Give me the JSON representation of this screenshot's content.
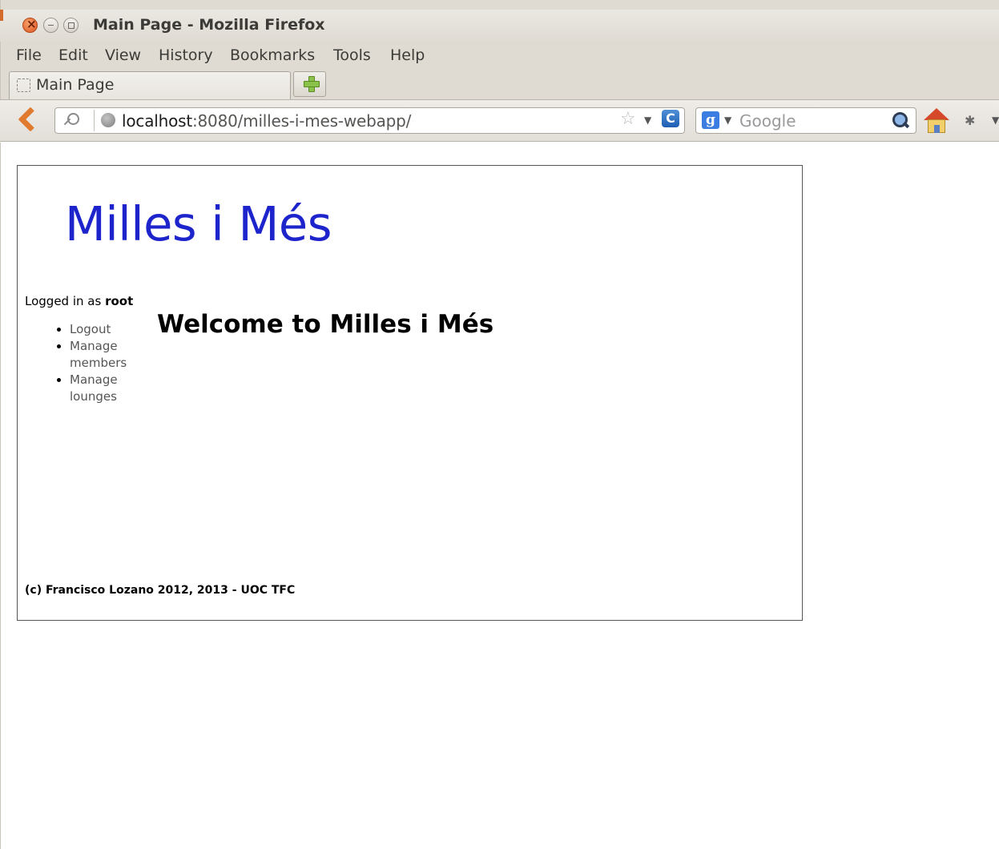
{
  "window": {
    "title": "Main Page - Mozilla Firefox"
  },
  "menubar": {
    "items": [
      "File",
      "Edit",
      "View",
      "History",
      "Bookmarks",
      "Tools",
      "Help"
    ]
  },
  "tabs": [
    {
      "label": "Main Page"
    }
  ],
  "navbar": {
    "url_host": "localhost",
    "url_rest": ":8080/milles-i-mes-webapp/",
    "search_placeholder": "Google"
  },
  "page": {
    "site_title": "Milles i Més",
    "logged_in_prefix": "Logged in as ",
    "logged_in_user": "root",
    "menu": [
      {
        "label": "Logout"
      },
      {
        "label": "Manage members"
      },
      {
        "label": "Manage lounges"
      }
    ],
    "welcome": "Welcome to Milles i Més",
    "footer": "(c) Francisco Lozano 2012, 2013 - UOC TFC"
  },
  "colors": {
    "site_title": "#1d24cc",
    "chrome_background": "#dfdbd2",
    "link": "#555555"
  }
}
